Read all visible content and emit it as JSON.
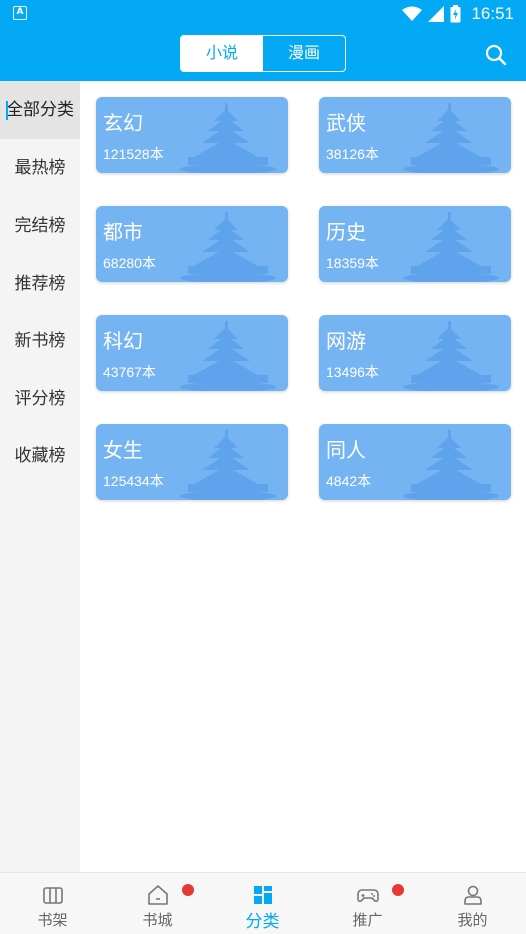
{
  "status_bar": {
    "app_icon": "A",
    "time": "16:51",
    "icons": [
      "wifi-icon",
      "signal-icon",
      "battery-icon"
    ]
  },
  "header": {
    "tabs": [
      {
        "label": "小说",
        "active": true
      },
      {
        "label": "漫画",
        "active": false
      }
    ],
    "search_icon": "search-icon"
  },
  "sidebar": {
    "items": [
      {
        "label": "全部分类",
        "active": true
      },
      {
        "label": "最热榜",
        "active": false
      },
      {
        "label": "完结榜",
        "active": false
      },
      {
        "label": "推荐榜",
        "active": false
      },
      {
        "label": "新书榜",
        "active": false
      },
      {
        "label": "评分榜",
        "active": false
      },
      {
        "label": "收藏榜",
        "active": false
      }
    ]
  },
  "categories": [
    {
      "name": "玄幻",
      "count": "121528本"
    },
    {
      "name": "武侠",
      "count": "38126本"
    },
    {
      "name": "都市",
      "count": "68280本"
    },
    {
      "name": "历史",
      "count": "18359本"
    },
    {
      "name": "科幻",
      "count": "43767本"
    },
    {
      "name": "网游",
      "count": "13496本"
    },
    {
      "name": "女生",
      "count": "125434本"
    },
    {
      "name": "同人",
      "count": "4842本"
    }
  ],
  "bottom_nav": {
    "items": [
      {
        "label": "书架",
        "icon": "bookshelf-icon",
        "active": false,
        "badge": false
      },
      {
        "label": "书城",
        "icon": "home-icon",
        "active": false,
        "badge": true
      },
      {
        "label": "分类",
        "icon": "category-icon",
        "active": true,
        "badge": false
      },
      {
        "label": "推广",
        "icon": "gamepad-icon",
        "active": false,
        "badge": true
      },
      {
        "label": "我的",
        "icon": "profile-icon",
        "active": false,
        "badge": false
      }
    ]
  },
  "colors": {
    "primary": "#03a9f4",
    "card": "#75b4f3",
    "badge": "#e53935"
  }
}
